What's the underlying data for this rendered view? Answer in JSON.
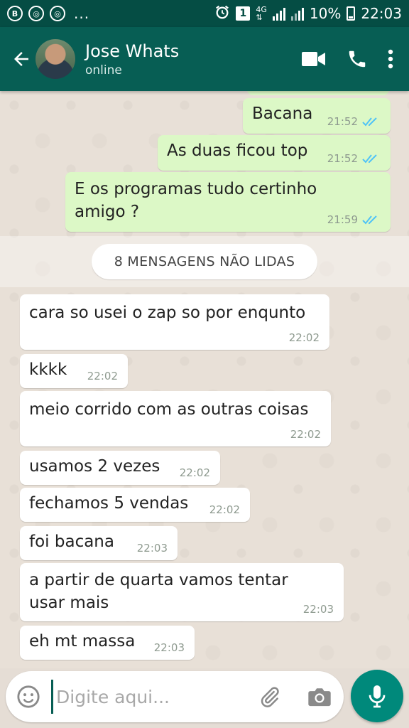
{
  "status_bar": {
    "left_badges": [
      "B",
      "◎",
      "◎"
    ],
    "overflow": "...",
    "sim_badge": "1",
    "network": "4G",
    "battery": "10%",
    "time": "22:03"
  },
  "header": {
    "contact_name": "Jose Whats",
    "contact_status": "online",
    "icons": [
      "back-arrow-icon",
      "video-call-icon",
      "phone-icon",
      "more-vert-icon"
    ]
  },
  "messages_outgoing": [
    {
      "text": "Bacana",
      "time": "21:52"
    },
    {
      "text": "As duas ficou top",
      "time": "21:52"
    },
    {
      "line1": "E os programas tudo certinho",
      "line2": "amigo ?",
      "time": "21:59"
    }
  ],
  "unread_banner": "8 MENSAGENS NÃO LIDAS",
  "messages_incoming": [
    {
      "text": "cara so usei o zap so por enqunto",
      "time": "22:02"
    },
    {
      "text": "kkkk",
      "time": "22:02"
    },
    {
      "text": "meio corrido com as outras coisas",
      "time": "22:02"
    },
    {
      "text": "usamos 2 vezes",
      "time": "22:02"
    },
    {
      "text": "fechamos 5 vendas",
      "time": "22:02"
    },
    {
      "text": "foi bacana",
      "time": "22:03"
    },
    {
      "line1": "a partir de quarta vamos tentar",
      "line2": "usar mais",
      "time": "22:03"
    },
    {
      "text": "eh mt massa",
      "time": "22:03"
    }
  ],
  "composer": {
    "placeholder": "Digite aqui..."
  },
  "colors": {
    "header": "#075e54",
    "status_bar": "#054d44",
    "outgoing_bubble": "#dcf8c6",
    "incoming_bubble": "#ffffff",
    "read_ticks": "#4fc3f7",
    "fab": "#00897b"
  }
}
